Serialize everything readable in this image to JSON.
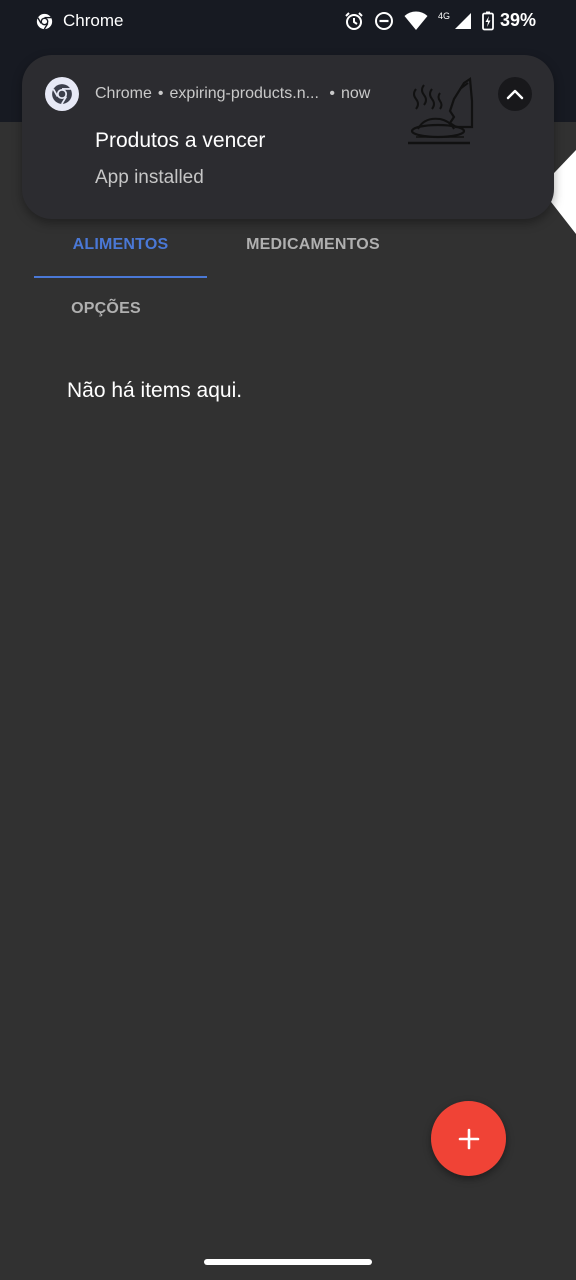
{
  "status_bar": {
    "app_name": "Chrome",
    "network_type": "4G",
    "battery": "39%"
  },
  "notification": {
    "app": "Chrome",
    "site": "expiring-products.n...",
    "time": "now",
    "title": "Produtos a vencer",
    "text": "App installed",
    "icons": [
      "chrome-icon",
      "food-plate-icon",
      "chevron-up-icon"
    ]
  },
  "tabs": [
    {
      "label": "ALIMENTOS",
      "active": true
    },
    {
      "label": "MEDICAMENTOS",
      "active": false
    },
    {
      "label": "OPÇÕES",
      "active": false
    }
  ],
  "content": {
    "empty_message": "Não há items aqui."
  },
  "fab": {
    "icon": "plus-icon"
  },
  "colors": {
    "background": "#313131",
    "status_bar": "#171a22",
    "accent": "#4a78d6",
    "fab": "#f04336",
    "notification_bg": "#2c2c30"
  }
}
